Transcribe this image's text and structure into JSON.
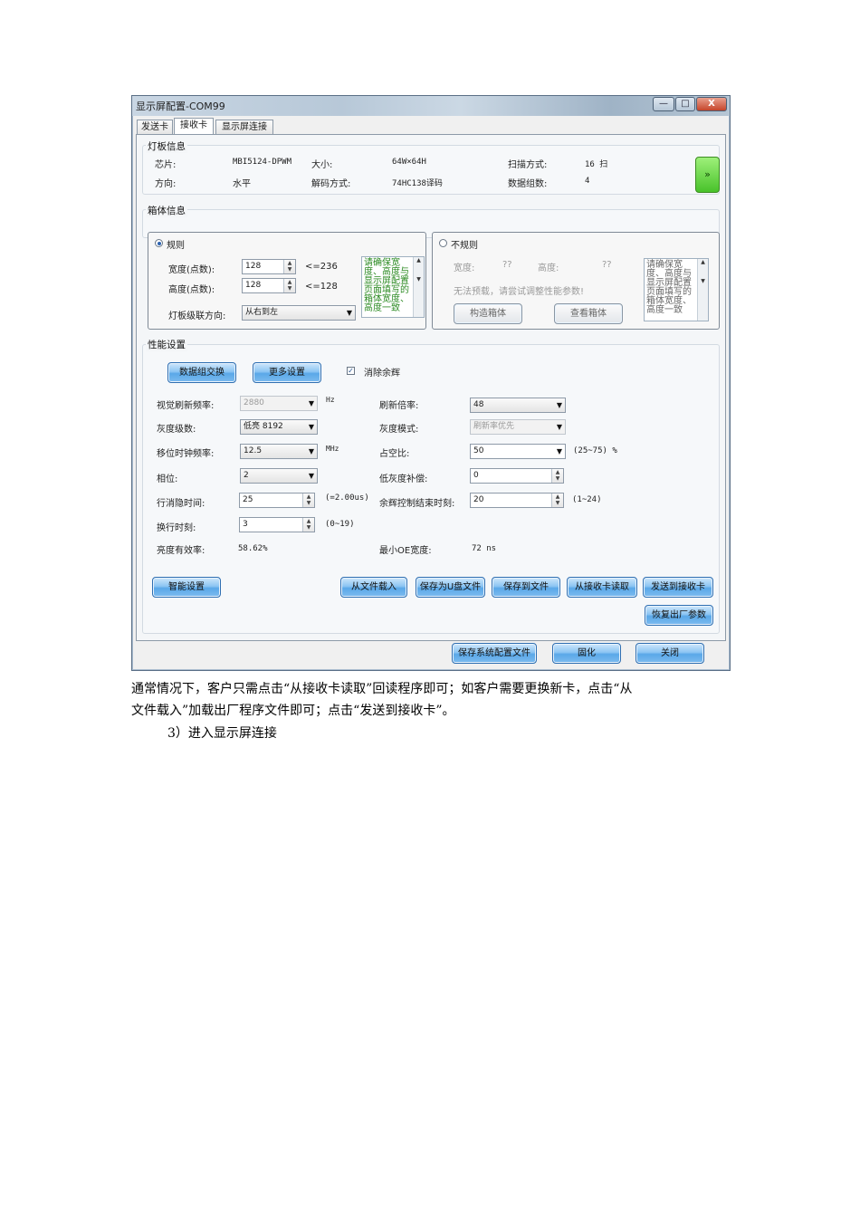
{
  "window": {
    "title": "显示屏配置-COM99",
    "btn_min": "—",
    "btn_max": "□",
    "btn_close": "X"
  },
  "tabs": [
    "发送卡",
    "接收卡",
    "显示屏连接"
  ],
  "module_info": {
    "group_label": "灯板信息",
    "chip_label": "芯片:",
    "chip_value": "MBI5124-DPWM",
    "size_label": "大小:",
    "size_value": "64W×64H",
    "scan_label": "扫描方式:",
    "scan_value": "16 扫",
    "direction_label": "方向:",
    "direction_value": "水平",
    "decode_label": "解码方式:",
    "decode_value": "74HC138译码",
    "data_groups_label": "数据组数:",
    "data_groups_value": "4",
    "expand_button": "»"
  },
  "cabinet_info": {
    "group_label": "箱体信息",
    "regular_label": "规则",
    "width_label": "宽度(点数):",
    "width_value": "128",
    "width_hint": "<=236",
    "height_label": "高度(点数):",
    "height_value": "128",
    "height_hint": "<=128",
    "cascade_label": "灯板级联方向:",
    "cascade_value": "从右到左",
    "regular_note": "请确保宽度、高度与显示屏配置页面填写的箱体宽度、高度一致",
    "irregular_label": "不规则",
    "irr_width_label": "宽度:",
    "irr_width_value": "??",
    "irr_height_label": "高度:",
    "irr_height_value": "??",
    "irr_message": "无法预载，请尝试调整性能参数!",
    "construct_button": "构造箱体",
    "view_button": "查看箱体",
    "irregular_note": "请确保宽度、高度与显示屏配置页面填写的箱体宽度、高度一致"
  },
  "performance": {
    "group_label": "性能设置",
    "data_swap_button": "数据组交换",
    "more_settings_button": "更多设置",
    "remove_ghost_label": "消除余辉",
    "visual_refresh_label": "视觉刷新频率:",
    "visual_refresh_value": "2880",
    "visual_refresh_unit": "Hz",
    "refresh_mult_label": "刷新倍率:",
    "refresh_mult_value": "48",
    "gray_level_label": "灰度级数:",
    "gray_level_value": "低亮 8192",
    "gray_mode_label": "灰度模式:",
    "gray_mode_value": "刷新率优先",
    "shift_clock_label": "移位时钟频率:",
    "shift_clock_value": "12.5",
    "shift_clock_unit": "MHz",
    "duty_label": "占空比:",
    "duty_value": "50",
    "duty_hint": "(25~75) %",
    "phase_label": "相位:",
    "phase_value": "2",
    "low_gray_label": "低灰度补偿:",
    "low_gray_value": "0",
    "blanking_label": "行消隐时间:",
    "blanking_value": "25",
    "blanking_hint": "(=2.00us)",
    "ghost_end_label": "余辉控制结束时刻:",
    "ghost_end_value": "20",
    "ghost_end_hint": "(1~24)",
    "line_change_label": "换行时刻:",
    "line_change_value": "3",
    "line_change_hint": "(0~19)",
    "brightness_eff_label": "亮度有效率:",
    "brightness_eff_value": "58.62%",
    "min_oe_label": "最小OE宽度:",
    "min_oe_value": "72 ns"
  },
  "actions": {
    "smart_setup": "智能设置",
    "load_file": "从文件载入",
    "save_udisk": "保存为U盘文件",
    "save_file": "保存到文件",
    "read_receiver": "从接收卡读取",
    "send_receiver": "发送到接收卡",
    "restore_factory": "恢复出厂参数"
  },
  "footer": {
    "save_config": "保存系统配置文件",
    "solidify": "固化",
    "close": "关闭"
  },
  "document": {
    "line1": "通常情况下，客户只需点击“从接收卡读取”回读程序即可；如客户需要更换新卡，点击“从",
    "line2": "文件载入”加载出厂程序文件即可；点击“发送到接收卡”。",
    "line3": "3）进入显示屏连接"
  }
}
